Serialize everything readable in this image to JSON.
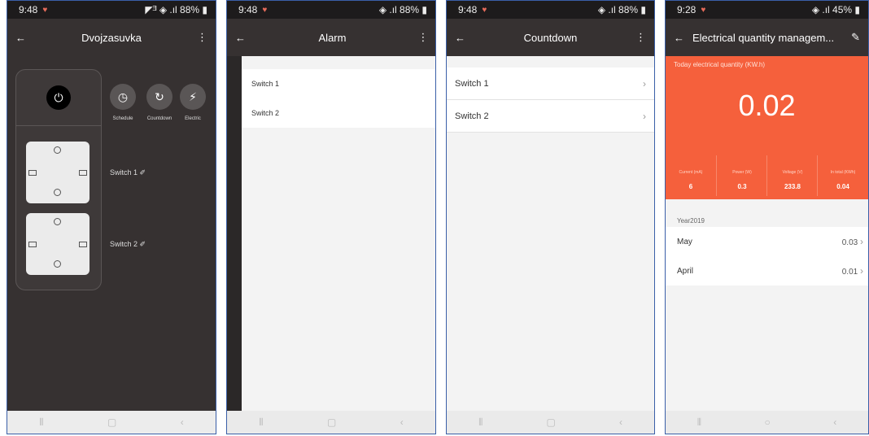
{
  "phone1": {
    "status": {
      "time": "9:48",
      "right": "◤ᴲ ◈ .ıl 88% ▮"
    },
    "title": "Dvojzasuvka",
    "features": [
      {
        "label": "Schedule",
        "icon": "clock-icon",
        "glyph": "◷"
      },
      {
        "label": "Countdown",
        "icon": "countdown-icon",
        "glyph": "↻"
      },
      {
        "label": "Electric",
        "icon": "lightning-icon",
        "glyph": "⚡"
      }
    ],
    "switches": [
      {
        "label": "Switch 1 ✐"
      },
      {
        "label": "Switch 2 ✐"
      }
    ]
  },
  "phone2": {
    "status": {
      "time": "9:48",
      "right": "◈ .ıl 88% ▮"
    },
    "title": "Alarm",
    "items": [
      {
        "label": "Switch 1"
      },
      {
        "label": "Switch 2"
      }
    ]
  },
  "phone3": {
    "status": {
      "time": "9:48",
      "right": "◈ .ıl 88% ▮"
    },
    "title": "Countdown",
    "items": [
      {
        "label": "Switch 1"
      },
      {
        "label": "Switch 2"
      }
    ]
  },
  "phone4": {
    "status": {
      "time": "9:28",
      "right": "◈ .ıl 45% ▮"
    },
    "title": "Electrical quantity managem...",
    "today_label": "Today electrical quantity (KW.h)",
    "today_value": "0.02",
    "stats": [
      {
        "label": "Current (mA)",
        "value": "6"
      },
      {
        "label": "Power (W)",
        "value": "0.3"
      },
      {
        "label": "Voltage (V)",
        "value": "233.8"
      },
      {
        "label": "In total (KWh)",
        "value": "0.04"
      }
    ],
    "year": "Year2019",
    "months": [
      {
        "label": "May",
        "value": "0.03"
      },
      {
        "label": "April",
        "value": "0.01"
      }
    ]
  },
  "colors": {
    "accent": "#f5603c",
    "dark": "#363131"
  }
}
